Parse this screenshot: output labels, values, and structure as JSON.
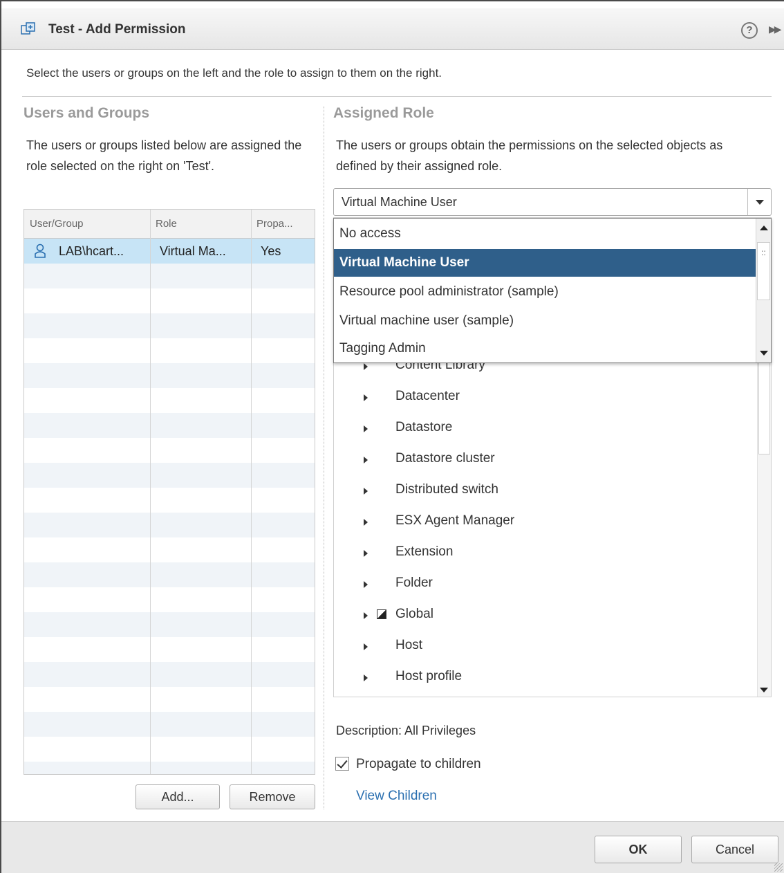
{
  "dialog": {
    "title": "Test - Add Permission",
    "help_label": "?",
    "more_label": "▶▶",
    "instruction": "Select the users or groups on the left and the role to assign to them on the right."
  },
  "users_groups": {
    "heading": "Users and Groups",
    "description": "The users or groups listed below are assigned the role selected on the right on 'Test'.",
    "columns": [
      "User/Group",
      "Role",
      "Propa..."
    ],
    "rows": [
      {
        "user": "LAB\\hcart...",
        "role": "Virtual Ma...",
        "propagate": "Yes"
      }
    ],
    "add_label": "Add...",
    "remove_label": "Remove"
  },
  "assigned_role": {
    "heading": "Assigned Role",
    "description": "The users or groups obtain the permissions on the selected objects as defined by their assigned role.",
    "selected_role": "Virtual Machine User",
    "options": [
      "No access",
      "Virtual Machine User",
      "Resource pool administrator (sample)",
      "Virtual machine user (sample)",
      "Tagging Admin"
    ],
    "privileges": [
      "Content Library",
      "Datacenter",
      "Datastore",
      "Datastore cluster",
      "Distributed switch",
      "ESX Agent Manager",
      "Extension",
      "Folder",
      "Global",
      "Host",
      "Host profile"
    ],
    "description_label": "Description:  All Privileges",
    "propagate_label": "Propagate to children",
    "view_children_label": "View Children"
  },
  "footer": {
    "ok_label": "OK",
    "cancel_label": "Cancel"
  },
  "colors": {
    "selected_option_bg": "#2f5f8a",
    "selected_row_bg": "#c7e4f6",
    "link": "#2a6fb0"
  }
}
